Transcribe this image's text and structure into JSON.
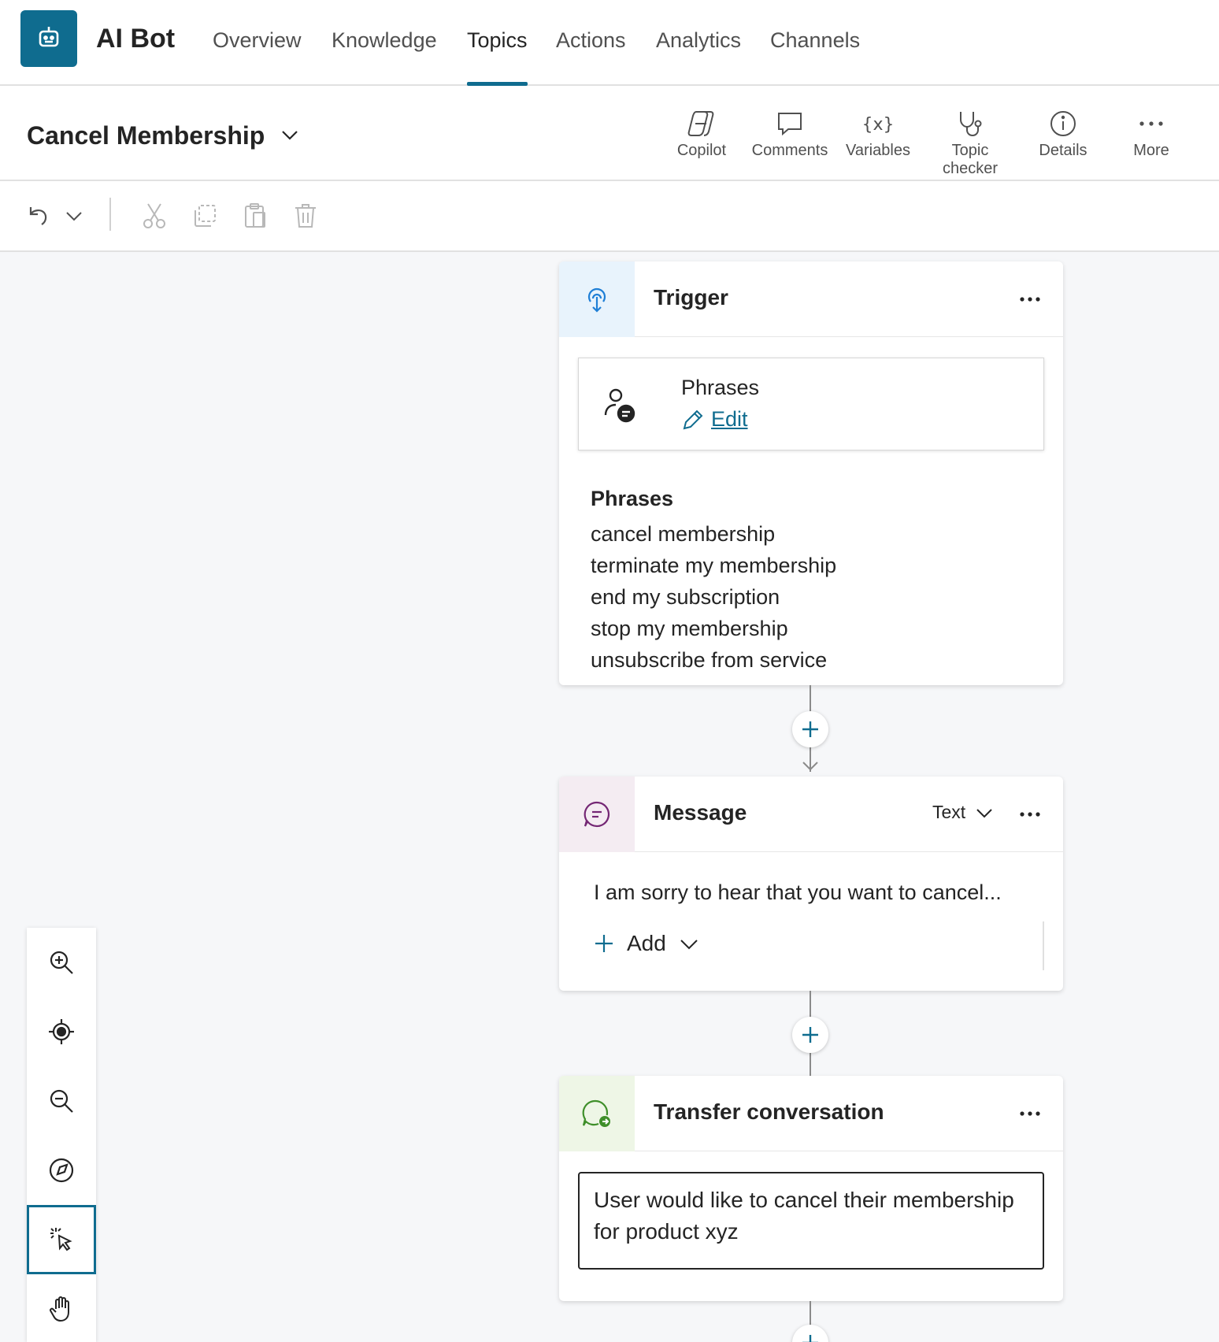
{
  "app": {
    "name": "AI Bot",
    "logo_icon": "bot-icon",
    "accent": "#0f6c8f"
  },
  "nav": {
    "tabs": [
      {
        "label": "Overview",
        "active": false
      },
      {
        "label": "Knowledge",
        "active": false
      },
      {
        "label": "Topics",
        "active": true
      },
      {
        "label": "Actions",
        "active": false
      },
      {
        "label": "Analytics",
        "active": false
      },
      {
        "label": "Channels",
        "active": false
      }
    ]
  },
  "topic": {
    "title": "Cancel Membership",
    "tools": [
      {
        "label": "Copilot",
        "icon": "copilot-icon"
      },
      {
        "label": "Comments",
        "icon": "comment-icon"
      },
      {
        "label": "Variables",
        "icon": "variables-icon"
      },
      {
        "label": "Topic checker",
        "icon": "stethoscope-icon"
      },
      {
        "label": "Details",
        "icon": "info-icon"
      },
      {
        "label": "More",
        "icon": "more-icon"
      }
    ]
  },
  "edit_toolbar": {
    "icons": [
      "undo-icon",
      "chevron-down-icon",
      "cut-icon",
      "copy-icon",
      "paste-icon",
      "delete-icon"
    ]
  },
  "trigger_node": {
    "title": "Trigger",
    "icon": "trigger-icon",
    "icon_bg": "#e8f3fc",
    "card_title": "Phrases",
    "edit_label": "Edit",
    "phrases_heading": "Phrases",
    "phrases": [
      "cancel membership",
      "terminate my membership",
      "end my subscription",
      "stop my membership",
      "unsubscribe from service"
    ]
  },
  "message_node": {
    "title": "Message",
    "icon": "message-icon",
    "icon_bg": "#f4ecf2",
    "type_label": "Text",
    "text": "I am sorry to hear that you want to cancel...",
    "add_label": "Add"
  },
  "transfer_node": {
    "title": "Transfer conversation",
    "icon": "transfer-icon",
    "icon_bg": "#eef6e6",
    "message": "User would like to cancel their membership for product xyz"
  },
  "zoom_panel": {
    "buttons": [
      "zoom-in-icon",
      "recenter-icon",
      "zoom-out-icon",
      "minimap-icon",
      "select-icon",
      "pan-icon"
    ],
    "selected": "select-icon"
  }
}
